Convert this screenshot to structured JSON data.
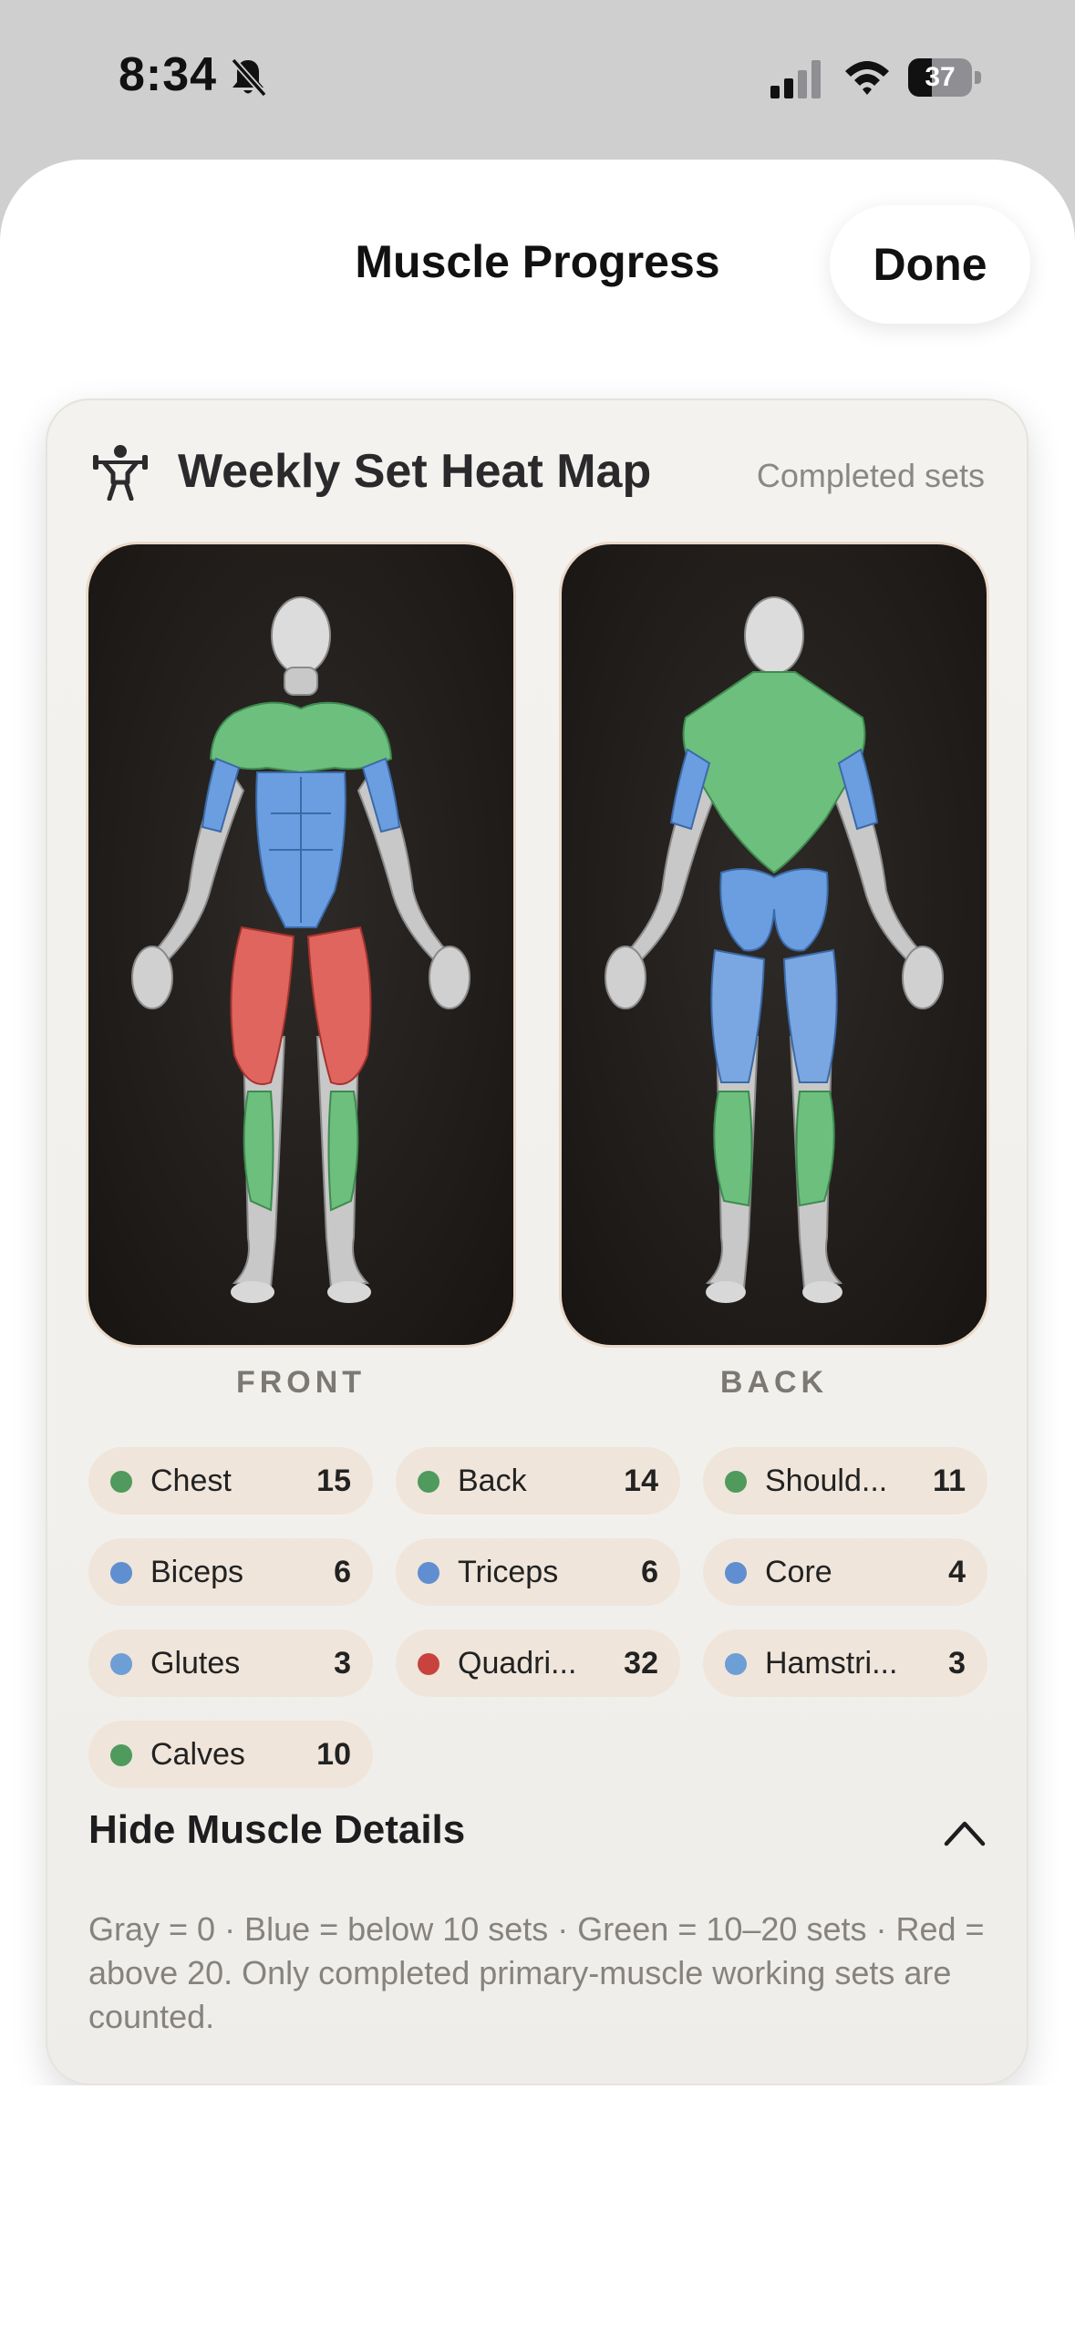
{
  "status": {
    "time": "8:34",
    "battery": "37",
    "battery_level": 0.37
  },
  "header": {
    "title": "Muscle Progress",
    "done_label": "Done"
  },
  "card": {
    "title": "Weekly Set Heat Map",
    "subtitle": "Completed sets",
    "front_label": "FRONT",
    "back_label": "BACK"
  },
  "colors": {
    "gray": "#9a9a9a",
    "blue": "#5f8fd0",
    "green": "#5a9a63",
    "red": "#c9433e",
    "chip_bg": "#efe5da",
    "accent_tan": "#ead9c8"
  },
  "muscles": [
    {
      "name": "Chest",
      "count": "15",
      "color": "#4f9a5c"
    },
    {
      "name": "Back",
      "count": "14",
      "color": "#4f9a5c"
    },
    {
      "name": "Should...",
      "count": "11",
      "color": "#4f9a5c"
    },
    {
      "name": "Biceps",
      "count": "6",
      "color": "#5f8fd0"
    },
    {
      "name": "Triceps",
      "count": "6",
      "color": "#5f8fd0"
    },
    {
      "name": "Core",
      "count": "4",
      "color": "#5f8fd0"
    },
    {
      "name": "Glutes",
      "count": "3",
      "color": "#6e9ed6"
    },
    {
      "name": "Quadri...",
      "count": "32",
      "color": "#c9433e"
    },
    {
      "name": "Hamstri...",
      "count": "3",
      "color": "#6e9ed6"
    },
    {
      "name": "Calves",
      "count": "10",
      "color": "#4f9a5c"
    }
  ],
  "details": {
    "toggle_label": "Hide Muscle Details",
    "note": "Gray = 0 · Blue = below 10 sets · Green = 10–20 sets · Red = above 20. Only completed primary-muscle working sets are counted."
  }
}
